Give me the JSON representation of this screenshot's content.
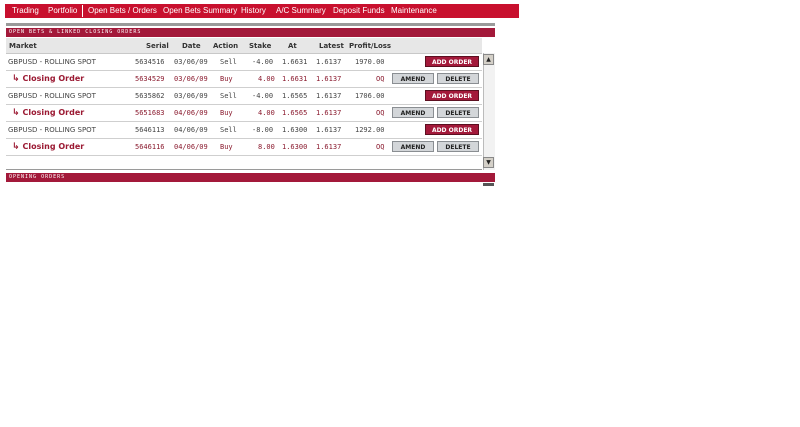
{
  "nav": {
    "items": [
      "Trading",
      "Portfolio",
      "Open Bets / Orders",
      "Open Bets Summary",
      "History",
      "A/C Summary",
      "Deposit Funds",
      "Maintenance"
    ]
  },
  "sections": {
    "open_bets_title": "OPEN BETS & LINKED CLOSING ORDERS",
    "opening_orders_title": "OPENING ORDERS"
  },
  "columns": {
    "market": "Market",
    "serial": "Serial",
    "date": "Date",
    "action": "Action",
    "stake": "Stake",
    "at": "At",
    "latest": "Latest",
    "pnl": "Profit/Loss"
  },
  "rows": [
    {
      "type": "bet",
      "market": "GBPUSD - ROLLING SPOT",
      "serial": "5634516",
      "date": "03/06/09",
      "action": "Sell",
      "stake": "-4.00",
      "at": "1.6631",
      "latest": "1.6137",
      "pnl": "1970.00",
      "button": "ADD ORDER"
    },
    {
      "type": "closing",
      "market": "Closing Order",
      "serial": "5634529",
      "date": "03/06/09",
      "action": "Buy",
      "stake": "4.00",
      "at": "1.6631",
      "latest": "1.6137",
      "pnl": "OQ",
      "amend": "AMEND",
      "delete": "DELETE"
    },
    {
      "type": "bet",
      "market": "GBPUSD - ROLLING SPOT",
      "serial": "5635862",
      "date": "03/06/09",
      "action": "Sell",
      "stake": "-4.00",
      "at": "1.6565",
      "latest": "1.6137",
      "pnl": "1706.00",
      "button": "ADD ORDER"
    },
    {
      "type": "closing",
      "market": "Closing Order",
      "serial": "5651683",
      "date": "04/06/09",
      "action": "Buy",
      "stake": "4.00",
      "at": "1.6565",
      "latest": "1.6137",
      "pnl": "OQ",
      "amend": "AMEND",
      "delete": "DELETE"
    },
    {
      "type": "bet",
      "market": "GBPUSD - ROLLING SPOT",
      "serial": "5646113",
      "date": "04/06/09",
      "action": "Sell",
      "stake": "-8.00",
      "at": "1.6300",
      "latest": "1.6137",
      "pnl": "1292.00",
      "button": "ADD ORDER"
    },
    {
      "type": "closing",
      "market": "Closing Order",
      "serial": "5646116",
      "date": "04/06/09",
      "action": "Buy",
      "stake": "8.00",
      "at": "1.6300",
      "latest": "1.6137",
      "pnl": "OQ",
      "amend": "AMEND",
      "delete": "DELETE"
    }
  ],
  "icons": {
    "closing_arrow": "return-arrow-icon",
    "scroll_up": "scroll-up-arrow-icon",
    "scroll_down": "scroll-down-arrow-icon"
  },
  "colors": {
    "brand_red": "#c8102e",
    "section_maroon": "#a3193a",
    "closing_text": "#9b1a33"
  }
}
